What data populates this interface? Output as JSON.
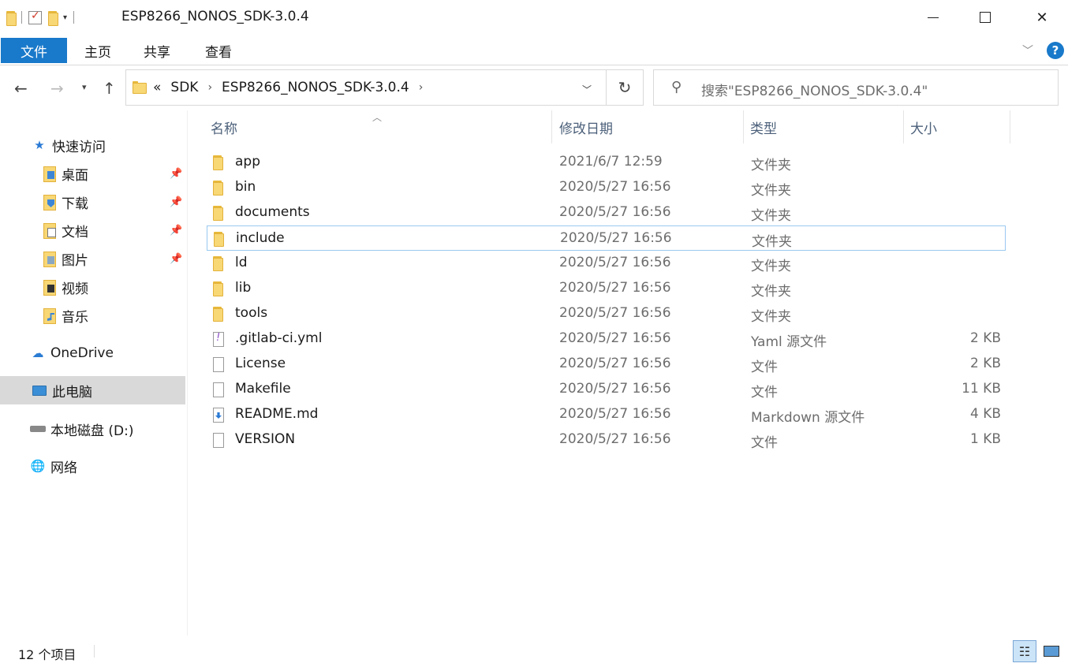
{
  "window": {
    "title": "ESP8266_NONOS_SDK-3.0.4"
  },
  "ribbon": {
    "tabs": [
      {
        "label": "文件"
      },
      {
        "label": "主页"
      },
      {
        "label": "共享"
      },
      {
        "label": "查看"
      }
    ]
  },
  "address": {
    "overflow": "«",
    "crumbs": [
      "SDK",
      "ESP8266_NONOS_SDK-3.0.4"
    ]
  },
  "search": {
    "placeholder": "搜索\"ESP8266_NONOS_SDK-3.0.4\""
  },
  "sidebar": {
    "quick_access": "快速访问",
    "pinned": [
      {
        "label": "桌面"
      },
      {
        "label": "下载"
      },
      {
        "label": "文档"
      },
      {
        "label": "图片"
      }
    ],
    "unpinned": [
      {
        "label": "视频"
      },
      {
        "label": "音乐"
      }
    ],
    "onedrive": "OneDrive",
    "this_pc": "此电脑",
    "local_disk": "本地磁盘 (D:)",
    "network": "网络"
  },
  "columns": {
    "name": "名称",
    "date": "修改日期",
    "type": "类型",
    "size": "大小"
  },
  "files": [
    {
      "name": "app",
      "date": "2021/6/7 12:59",
      "type": "文件夹",
      "size": "",
      "kind": "folder"
    },
    {
      "name": "bin",
      "date": "2020/5/27 16:56",
      "type": "文件夹",
      "size": "",
      "kind": "folder"
    },
    {
      "name": "documents",
      "date": "2020/5/27 16:56",
      "type": "文件夹",
      "size": "",
      "kind": "folder"
    },
    {
      "name": "include",
      "date": "2020/5/27 16:56",
      "type": "文件夹",
      "size": "",
      "kind": "folder"
    },
    {
      "name": "ld",
      "date": "2020/5/27 16:56",
      "type": "文件夹",
      "size": "",
      "kind": "folder"
    },
    {
      "name": "lib",
      "date": "2020/5/27 16:56",
      "type": "文件夹",
      "size": "",
      "kind": "folder"
    },
    {
      "name": "tools",
      "date": "2020/5/27 16:56",
      "type": "文件夹",
      "size": "",
      "kind": "folder"
    },
    {
      "name": ".gitlab-ci.yml",
      "date": "2020/5/27 16:56",
      "type": "Yaml 源文件",
      "size": "2 KB",
      "kind": "yaml"
    },
    {
      "name": "License",
      "date": "2020/5/27 16:56",
      "type": "文件",
      "size": "2 KB",
      "kind": "file"
    },
    {
      "name": "Makefile",
      "date": "2020/5/27 16:56",
      "type": "文件",
      "size": "11 KB",
      "kind": "file"
    },
    {
      "name": "README.md",
      "date": "2020/5/27 16:56",
      "type": "Markdown 源文件",
      "size": "4 KB",
      "kind": "md"
    },
    {
      "name": "VERSION",
      "date": "2020/5/27 16:56",
      "type": "文件",
      "size": "1 KB",
      "kind": "file"
    }
  ],
  "status": {
    "item_count": "12 个项目"
  }
}
